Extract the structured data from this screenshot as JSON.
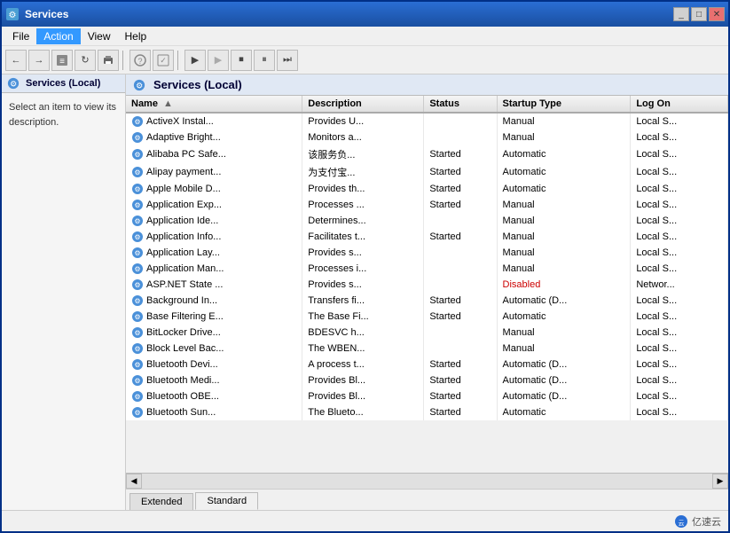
{
  "window": {
    "title": "Services",
    "title_bar_icon": "⚙"
  },
  "menu": {
    "items": [
      "File",
      "Action",
      "View",
      "Help"
    ]
  },
  "toolbar": {
    "buttons": [
      "←",
      "→",
      "☰",
      "↻",
      "🖨",
      "|",
      "❓",
      "☑",
      "|",
      "▶",
      "▶▶",
      "⏹",
      "⏸",
      "⏭"
    ]
  },
  "left_panel": {
    "title": "Services (Local)",
    "description": "Select an item to view its description."
  },
  "right_panel": {
    "title": "Services (Local)"
  },
  "table": {
    "columns": [
      {
        "id": "name",
        "label": "Name",
        "sort": "asc"
      },
      {
        "id": "desc",
        "label": "Description"
      },
      {
        "id": "status",
        "label": "Status"
      },
      {
        "id": "startup",
        "label": "Startup Type"
      },
      {
        "id": "logon",
        "label": "Log On"
      }
    ],
    "rows": [
      {
        "name": "ActiveX Instal...",
        "desc": "Provides U...",
        "status": "",
        "startup": "Manual",
        "logon": "Local S..."
      },
      {
        "name": "Adaptive Bright...",
        "desc": "Monitors a...",
        "status": "",
        "startup": "Manual",
        "logon": "Local S..."
      },
      {
        "name": "Alibaba PC Safe...",
        "desc": "该服务负...",
        "status": "Started",
        "startup": "Automatic",
        "logon": "Local S..."
      },
      {
        "name": "Alipay payment...",
        "desc": "为支付宝...",
        "status": "Started",
        "startup": "Automatic",
        "logon": "Local S..."
      },
      {
        "name": "Apple Mobile D...",
        "desc": "Provides th...",
        "status": "Started",
        "startup": "Automatic",
        "logon": "Local S..."
      },
      {
        "name": "Application Exp...",
        "desc": "Processes ...",
        "status": "Started",
        "startup": "Manual",
        "logon": "Local S..."
      },
      {
        "name": "Application Ide...",
        "desc": "Determines...",
        "status": "",
        "startup": "Manual",
        "logon": "Local S..."
      },
      {
        "name": "Application Info...",
        "desc": "Facilitates t...",
        "status": "Started",
        "startup": "Manual",
        "logon": "Local S..."
      },
      {
        "name": "Application Lay...",
        "desc": "Provides s...",
        "status": "",
        "startup": "Manual",
        "logon": "Local S..."
      },
      {
        "name": "Application Man...",
        "desc": "Processes i...",
        "status": "",
        "startup": "Manual",
        "logon": "Local S..."
      },
      {
        "name": "ASP.NET State ...",
        "desc": "Provides s...",
        "status": "",
        "startup": "Disabled",
        "logon": "Networ..."
      },
      {
        "name": "Background In...",
        "desc": "Transfers fi...",
        "status": "Started",
        "startup": "Automatic (D...",
        "logon": "Local S..."
      },
      {
        "name": "Base Filtering E...",
        "desc": "The Base Fi...",
        "status": "Started",
        "startup": "Automatic",
        "logon": "Local S..."
      },
      {
        "name": "BitLocker Drive...",
        "desc": "BDESVC h...",
        "status": "",
        "startup": "Manual",
        "logon": "Local S..."
      },
      {
        "name": "Block Level Bac...",
        "desc": "The WBEN...",
        "status": "",
        "startup": "Manual",
        "logon": "Local S..."
      },
      {
        "name": "Bluetooth Devi...",
        "desc": "A process t...",
        "status": "Started",
        "startup": "Automatic (D...",
        "logon": "Local S..."
      },
      {
        "name": "Bluetooth Medi...",
        "desc": "Provides Bl...",
        "status": "Started",
        "startup": "Automatic (D...",
        "logon": "Local S..."
      },
      {
        "name": "Bluetooth OBE...",
        "desc": "Provides Bl...",
        "status": "Started",
        "startup": "Automatic (D...",
        "logon": "Local S..."
      },
      {
        "name": "Bluetooth Sun...",
        "desc": "The Blueto...",
        "status": "Started",
        "startup": "Automatic",
        "logon": "Local S..."
      }
    ]
  },
  "tabs": [
    {
      "label": "Extended",
      "active": false
    },
    {
      "label": "Standard",
      "active": true
    }
  ],
  "status_bar": {
    "logo_text": "亿速云"
  }
}
